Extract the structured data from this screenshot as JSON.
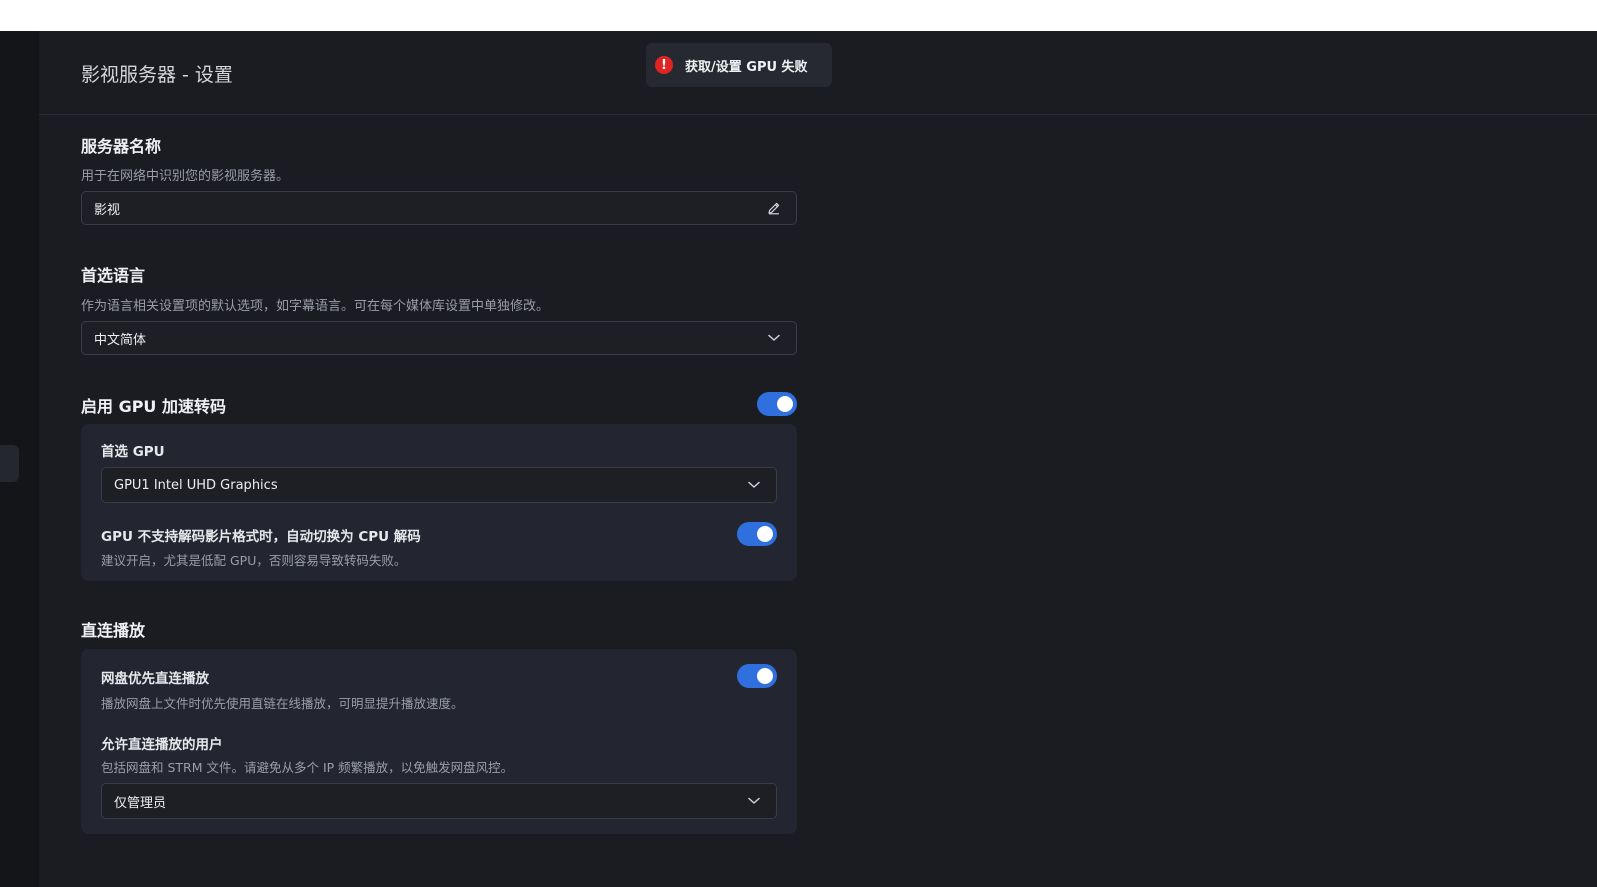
{
  "header": {
    "title": "影视服务器 - 设置"
  },
  "toast": {
    "icon": "error-icon",
    "text": "获取/设置 GPU 失败",
    "color": "#e02424"
  },
  "server_name": {
    "title": "服务器名称",
    "description": "用于在网络中识别您的影视服务器。",
    "value": "影视",
    "icon": "edit-pencil-icon"
  },
  "language": {
    "title": "首选语言",
    "description": "作为语言相关设置项的默认选项，如字幕语言。可在每个媒体库设置中单独修改。",
    "selected": "中文简体"
  },
  "gpu": {
    "title": "启用 GPU 加速转码",
    "enabled": true,
    "preferred_label": "首选 GPU",
    "preferred_value": "GPU1 Intel UHD Graphics",
    "fallback_label": "GPU 不支持解码影片格式时，自动切换为 CPU 解码",
    "fallback_desc": "建议开启，尤其是低配 GPU，否则容易导致转码失败。",
    "fallback_enabled": true
  },
  "direct_play": {
    "title": "直连播放",
    "netdisk_label": "网盘优先直连播放",
    "netdisk_desc": "播放网盘上文件时优先使用直链在线播放，可明显提升播放速度。",
    "netdisk_enabled": true,
    "users_label": "允许直连播放的用户",
    "users_desc": "包括网盘和 STRM 文件。请避免从多个 IP 频繁播放，以免触发网盘风控。",
    "users_value": "仅管理员"
  },
  "colors": {
    "background": "#1a1c21",
    "card": "#232630",
    "accent": "#2f6fde"
  }
}
